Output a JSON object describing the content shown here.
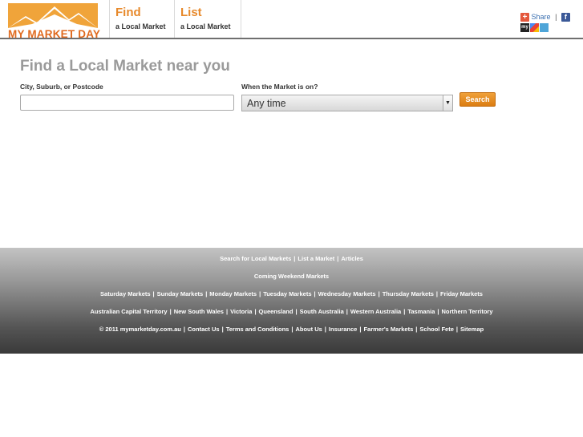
{
  "header": {
    "logo_text": "MY MARKET DAY",
    "nav": [
      {
        "big": "Find",
        "small": "a Local Market"
      },
      {
        "big": "List",
        "small": "a Local Market"
      }
    ],
    "share": {
      "label": "Share",
      "separator": "|"
    }
  },
  "main": {
    "title": "Find a Local Market near you",
    "city_label": "City, Suburb, or Postcode",
    "city_value": "",
    "when_label": "When the Market is on?",
    "when_value": "Any time",
    "search_button": "Search"
  },
  "footer": {
    "row1": [
      "Search for Local Markets",
      "List a Market",
      "Articles"
    ],
    "row2": [
      "Coming Weekend Markets"
    ],
    "row3": [
      "Saturday Markets",
      "Sunday Markets",
      "Monday Markets",
      "Tuesday Markets",
      "Wednesday Markets",
      "Thursday Markets",
      "Friday Markets"
    ],
    "row4": [
      "Australian Capital Territory",
      "New South Wales",
      "Victoria",
      "Queensland",
      "South Australia",
      "Western Australia",
      "Tasmania",
      "Northern Territory"
    ],
    "row5": [
      "© 2011 mymarketday.com.au",
      "Contact Us",
      "Terms and Conditions",
      "About Us",
      "Insurance",
      "Farmer's Markets",
      "School Fete",
      "Sitemap"
    ],
    "separator": "|"
  },
  "colors": {
    "brand_orange": "#e7892b",
    "logo_bg": "#f0a43a",
    "button": "#db7d12"
  }
}
